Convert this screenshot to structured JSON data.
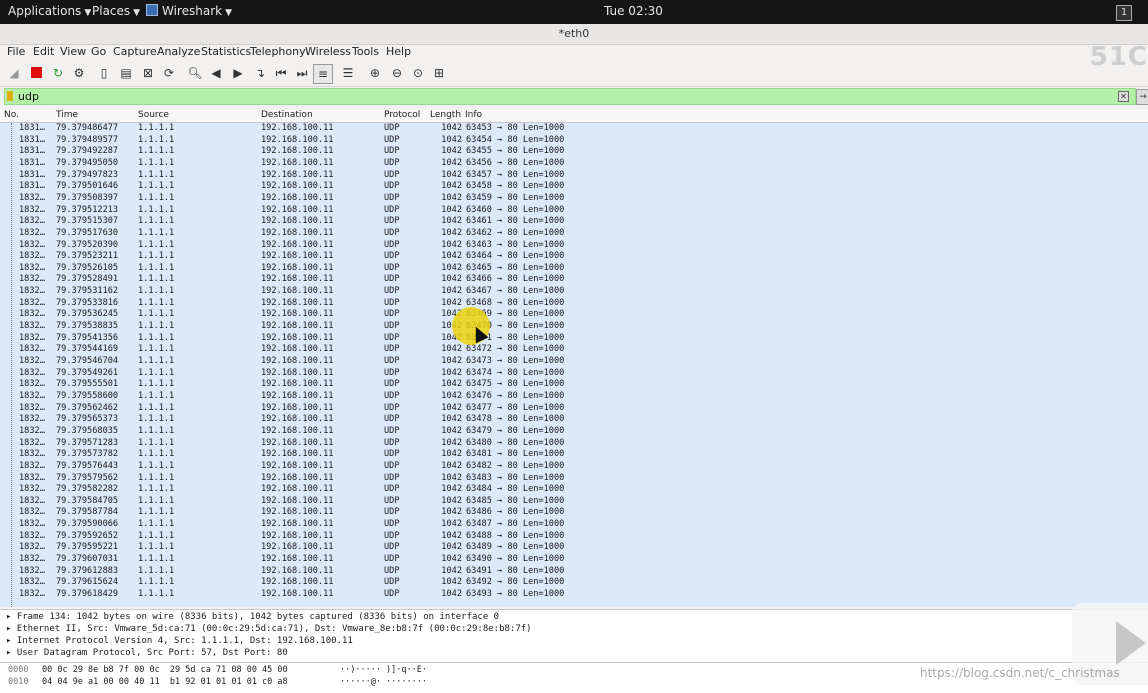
{
  "topbar": {
    "applications": "Applications",
    "places": "Places",
    "app_name": "Wireshark",
    "clock": "Tue 02:30",
    "workspace": "1"
  },
  "window": {
    "title": "*eth0"
  },
  "menu": [
    "File",
    "Edit",
    "View",
    "Go",
    "Capture",
    "Analyze",
    "Statistics",
    "Telephony",
    "Wireless",
    "Tools",
    "Help"
  ],
  "watermark_text": "51C",
  "filter": {
    "value": "udp",
    "color": "#b3f0a8"
  },
  "columns": [
    "No.",
    "Time",
    "Source",
    "Destination",
    "Protocol",
    "Length",
    "Info"
  ],
  "packets": [
    {
      "no": "1831…",
      "time": "79.379486477",
      "src": "1.1.1.1",
      "dst": "192.168.100.11",
      "proto": "UDP",
      "len": "1042",
      "info": "63453 → 80 Len=1000"
    },
    {
      "no": "1831…",
      "time": "79.379489577",
      "src": "1.1.1.1",
      "dst": "192.168.100.11",
      "proto": "UDP",
      "len": "1042",
      "info": "63454 → 80 Len=1000"
    },
    {
      "no": "1831…",
      "time": "79.379492287",
      "src": "1.1.1.1",
      "dst": "192.168.100.11",
      "proto": "UDP",
      "len": "1042",
      "info": "63455 → 80 Len=1000"
    },
    {
      "no": "1831…",
      "time": "79.379495050",
      "src": "1.1.1.1",
      "dst": "192.168.100.11",
      "proto": "UDP",
      "len": "1042",
      "info": "63456 → 80 Len=1000"
    },
    {
      "no": "1831…",
      "time": "79.379497823",
      "src": "1.1.1.1",
      "dst": "192.168.100.11",
      "proto": "UDP",
      "len": "1042",
      "info": "63457 → 80 Len=1000"
    },
    {
      "no": "1831…",
      "time": "79.379501646",
      "src": "1.1.1.1",
      "dst": "192.168.100.11",
      "proto": "UDP",
      "len": "1042",
      "info": "63458 → 80 Len=1000"
    },
    {
      "no": "1832…",
      "time": "79.379508397",
      "src": "1.1.1.1",
      "dst": "192.168.100.11",
      "proto": "UDP",
      "len": "1042",
      "info": "63459 → 80 Len=1000"
    },
    {
      "no": "1832…",
      "time": "79.379512213",
      "src": "1.1.1.1",
      "dst": "192.168.100.11",
      "proto": "UDP",
      "len": "1042",
      "info": "63460 → 80 Len=1000"
    },
    {
      "no": "1832…",
      "time": "79.379515307",
      "src": "1.1.1.1",
      "dst": "192.168.100.11",
      "proto": "UDP",
      "len": "1042",
      "info": "63461 → 80 Len=1000"
    },
    {
      "no": "1832…",
      "time": "79.379517630",
      "src": "1.1.1.1",
      "dst": "192.168.100.11",
      "proto": "UDP",
      "len": "1042",
      "info": "63462 → 80 Len=1000"
    },
    {
      "no": "1832…",
      "time": "79.379520390",
      "src": "1.1.1.1",
      "dst": "192.168.100.11",
      "proto": "UDP",
      "len": "1042",
      "info": "63463 → 80 Len=1000"
    },
    {
      "no": "1832…",
      "time": "79.379523211",
      "src": "1.1.1.1",
      "dst": "192.168.100.11",
      "proto": "UDP",
      "len": "1042",
      "info": "63464 → 80 Len=1000"
    },
    {
      "no": "1832…",
      "time": "79.379526105",
      "src": "1.1.1.1",
      "dst": "192.168.100.11",
      "proto": "UDP",
      "len": "1042",
      "info": "63465 → 80 Len=1000"
    },
    {
      "no": "1832…",
      "time": "79.379528491",
      "src": "1.1.1.1",
      "dst": "192.168.100.11",
      "proto": "UDP",
      "len": "1042",
      "info": "63466 → 80 Len=1000"
    },
    {
      "no": "1832…",
      "time": "79.379531162",
      "src": "1.1.1.1",
      "dst": "192.168.100.11",
      "proto": "UDP",
      "len": "1042",
      "info": "63467 → 80 Len=1000"
    },
    {
      "no": "1832…",
      "time": "79.379533816",
      "src": "1.1.1.1",
      "dst": "192.168.100.11",
      "proto": "UDP",
      "len": "1042",
      "info": "63468 → 80 Len=1000"
    },
    {
      "no": "1832…",
      "time": "79.379536245",
      "src": "1.1.1.1",
      "dst": "192.168.100.11",
      "proto": "UDP",
      "len": "1042",
      "info": "63469 → 80 Len=1000"
    },
    {
      "no": "1832…",
      "time": "79.379538835",
      "src": "1.1.1.1",
      "dst": "192.168.100.11",
      "proto": "UDP",
      "len": "1042",
      "info": "63470 → 80 Len=1000"
    },
    {
      "no": "1832…",
      "time": "79.379541356",
      "src": "1.1.1.1",
      "dst": "192.168.100.11",
      "proto": "UDP",
      "len": "1042",
      "info": "63471 → 80 Len=1000"
    },
    {
      "no": "1832…",
      "time": "79.379544169",
      "src": "1.1.1.1",
      "dst": "192.168.100.11",
      "proto": "UDP",
      "len": "1042",
      "info": "63472 → 80 Len=1000"
    },
    {
      "no": "1832…",
      "time": "79.379546704",
      "src": "1.1.1.1",
      "dst": "192.168.100.11",
      "proto": "UDP",
      "len": "1042",
      "info": "63473 → 80 Len=1000"
    },
    {
      "no": "1832…",
      "time": "79.379549261",
      "src": "1.1.1.1",
      "dst": "192.168.100.11",
      "proto": "UDP",
      "len": "1042",
      "info": "63474 → 80 Len=1000"
    },
    {
      "no": "1832…",
      "time": "79.379555501",
      "src": "1.1.1.1",
      "dst": "192.168.100.11",
      "proto": "UDP",
      "len": "1042",
      "info": "63475 → 80 Len=1000"
    },
    {
      "no": "1832…",
      "time": "79.379558600",
      "src": "1.1.1.1",
      "dst": "192.168.100.11",
      "proto": "UDP",
      "len": "1042",
      "info": "63476 → 80 Len=1000"
    },
    {
      "no": "1832…",
      "time": "79.379562462",
      "src": "1.1.1.1",
      "dst": "192.168.100.11",
      "proto": "UDP",
      "len": "1042",
      "info": "63477 → 80 Len=1000"
    },
    {
      "no": "1832…",
      "time": "79.379565373",
      "src": "1.1.1.1",
      "dst": "192.168.100.11",
      "proto": "UDP",
      "len": "1042",
      "info": "63478 → 80 Len=1000"
    },
    {
      "no": "1832…",
      "time": "79.379568035",
      "src": "1.1.1.1",
      "dst": "192.168.100.11",
      "proto": "UDP",
      "len": "1042",
      "info": "63479 → 80 Len=1000"
    },
    {
      "no": "1832…",
      "time": "79.379571283",
      "src": "1.1.1.1",
      "dst": "192.168.100.11",
      "proto": "UDP",
      "len": "1042",
      "info": "63480 → 80 Len=1000"
    },
    {
      "no": "1832…",
      "time": "79.379573782",
      "src": "1.1.1.1",
      "dst": "192.168.100.11",
      "proto": "UDP",
      "len": "1042",
      "info": "63481 → 80 Len=1000"
    },
    {
      "no": "1832…",
      "time": "79.379576443",
      "src": "1.1.1.1",
      "dst": "192.168.100.11",
      "proto": "UDP",
      "len": "1042",
      "info": "63482 → 80 Len=1000"
    },
    {
      "no": "1832…",
      "time": "79.379579562",
      "src": "1.1.1.1",
      "dst": "192.168.100.11",
      "proto": "UDP",
      "len": "1042",
      "info": "63483 → 80 Len=1000"
    },
    {
      "no": "1832…",
      "time": "79.379582282",
      "src": "1.1.1.1",
      "dst": "192.168.100.11",
      "proto": "UDP",
      "len": "1042",
      "info": "63484 → 80 Len=1000"
    },
    {
      "no": "1832…",
      "time": "79.379584705",
      "src": "1.1.1.1",
      "dst": "192.168.100.11",
      "proto": "UDP",
      "len": "1042",
      "info": "63485 → 80 Len=1000"
    },
    {
      "no": "1832…",
      "time": "79.379587784",
      "src": "1.1.1.1",
      "dst": "192.168.100.11",
      "proto": "UDP",
      "len": "1042",
      "info": "63486 → 80 Len=1000"
    },
    {
      "no": "1832…",
      "time": "79.379590066",
      "src": "1.1.1.1",
      "dst": "192.168.100.11",
      "proto": "UDP",
      "len": "1042",
      "info": "63487 → 80 Len=1000"
    },
    {
      "no": "1832…",
      "time": "79.379592652",
      "src": "1.1.1.1",
      "dst": "192.168.100.11",
      "proto": "UDP",
      "len": "1042",
      "info": "63488 → 80 Len=1000"
    },
    {
      "no": "1832…",
      "time": "79.379595221",
      "src": "1.1.1.1",
      "dst": "192.168.100.11",
      "proto": "UDP",
      "len": "1042",
      "info": "63489 → 80 Len=1000"
    },
    {
      "no": "1832…",
      "time": "79.379607031",
      "src": "1.1.1.1",
      "dst": "192.168.100.11",
      "proto": "UDP",
      "len": "1042",
      "info": "63490 → 80 Len=1000"
    },
    {
      "no": "1832…",
      "time": "79.379612883",
      "src": "1.1.1.1",
      "dst": "192.168.100.11",
      "proto": "UDP",
      "len": "1042",
      "info": "63491 → 80 Len=1000"
    },
    {
      "no": "1832…",
      "time": "79.379615624",
      "src": "1.1.1.1",
      "dst": "192.168.100.11",
      "proto": "UDP",
      "len": "1042",
      "info": "63492 → 80 Len=1000"
    },
    {
      "no": "1832…",
      "time": "79.379618429",
      "src": "1.1.1.1",
      "dst": "192.168.100.11",
      "proto": "UDP",
      "len": "1042",
      "info": "63493 → 80 Len=1000"
    }
  ],
  "details": [
    "Frame 134: 1042 bytes on wire (8336 bits), 1042 bytes captured (8336 bits) on interface 0",
    "Ethernet II, Src: Vmware_5d:ca:71 (00:0c:29:5d:ca:71), Dst: Vmware_8e:b8:7f (00:0c:29:8e:b8:7f)",
    "Internet Protocol Version 4, Src: 1.1.1.1, Dst: 192.168.100.11",
    "User Datagram Protocol, Src Port: 57, Dst Port: 80"
  ],
  "hex": [
    {
      "offset": "0000",
      "bytes": "00 0c 29 8e b8 7f 00 0c  29 5d ca 71 08 00 45 00",
      "ascii": "··)····· )]·q··E·"
    },
    {
      "offset": "0010",
      "bytes": "04 04 9e a1 00 00 40 11  b1 92 01 01 01 01 c0 a8",
      "ascii": "······@· ········"
    }
  ],
  "overlay_watermark": "https://blog.csdn.net/c_christmas"
}
